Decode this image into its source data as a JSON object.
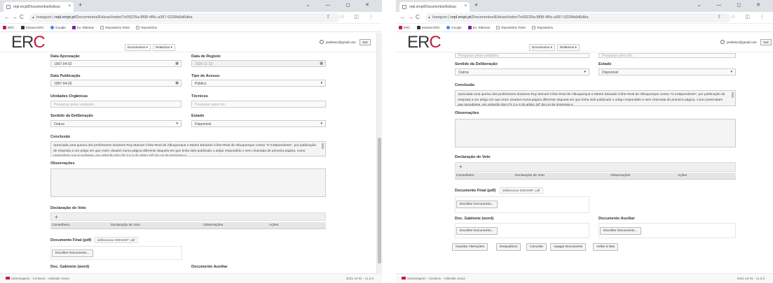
{
  "browser": {
    "tab_title": "repl.ercpt/Documentos/Edicao",
    "tab_close": "×",
    "new_tab": "+",
    "window_controls": "⌄ — ◻ ✕",
    "nav_back": "←",
    "nav_forward": "→",
    "nav_reload": "C",
    "url_prefix": "Inseguro | ",
    "url_host": "repl.ercpt.pt",
    "url_path": "/Documentos/Edicao/Index/7e09225a-8f98-4f6c-a367-0239fa9d6dba",
    "toolbar_icons": "⇪ ☆ ◫ ⋮",
    "bookmarks": [
      "ERC",
      "Intranet ERC",
      "Google",
      "Ex. Ribeiras",
      "Repositório Teste",
      "Repositório"
    ]
  },
  "header": {
    "logo_er": "ER",
    "logo_c": "C",
    "menu_documentos": "Documentos ▾",
    "menu_relatorios": "Relatórios ▾",
    "user_email": "jselektoz@gmail.com",
    "logout": "Sair"
  },
  "form": {
    "data_aprovacao_label": "Data Aprovação",
    "data_aprovacao_value": "1997-04-02",
    "data_registo_label": "Data de Registo",
    "data_registo_value": "2020-11-13",
    "data_publicacao_label": "Data Publicação",
    "data_publicacao_value": "1997-04-02",
    "tipo_acesso_label": "Tipo de Acesso",
    "tipo_acesso_value": "Público",
    "unidades_label": "Unidades Orgânicas",
    "unidades_placeholder": "Pesquisar pelas unidades",
    "tecnicos_label": "Técnicos",
    "tecnicos_placeholder": "Pesquisar pelos téc.",
    "sentido_label": "Sentido da Deliberação",
    "sentido_value": "Outros",
    "estado_label": "Estado",
    "estado_value": "Disponível",
    "conclusao_label": "Conclusão",
    "conclusao_text": "Apreciada uma queixa dos professores doutores Ruy Manuel Côrte-Real de Albuquerque e Martin Eduardo Côrte-Real de Albuquerque contra \"O Independente\", por publicação de resposta a um artigo em que eram visados numa página diferente daquela em que tinha sido publicado o artigo respondido e sem chamada de primeira página, como pretendiam que sucedesse, em violação dos nºs 3 e 4 do artigo 16º da Lei de Imprensa e",
    "observacoes_label": "Observações",
    "declaracao_label": "Declaração de Voto",
    "add_symbol": "+",
    "col_conselheiro": "Conselheiro",
    "col_declaracao": "Declaração de Voto",
    "col_observacoes": "Observações",
    "col_acoes": "Ações",
    "documento_final_label": "Documento Final (pdf)",
    "documento_final_file": "deliberacao-29031997 .pdf",
    "escolher_documento": "Escolher Documento...",
    "doc_gabinete_label": "Doc. Gabinete (word)",
    "doc_auxiliar_label": "Documento Auxiliar"
  },
  "actions": {
    "guardar": "Guardar Alterações",
    "despublicar": "Despublicar",
    "cancelar": "Cancelar",
    "apagar": "Apagar Documento",
    "voltar": "Voltar à lista"
  },
  "footer": {
    "left": "Uteensagens · Contacto · Adelaide Jesus",
    "right": "2021-12-01 - v1.3.0"
  },
  "icons": {
    "calendar": "▦",
    "caret": "▾",
    "lock": "▲",
    "user": "user-icon"
  },
  "colors": {
    "brand_red": "#c41e3a",
    "field_bg": "#fafafa",
    "panel_bg": "#efefef"
  }
}
